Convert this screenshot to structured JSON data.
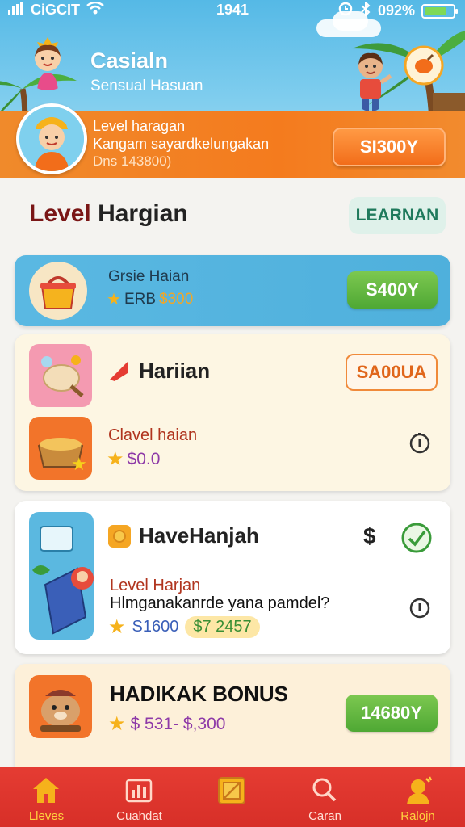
{
  "status_bar": {
    "carrier": "CiGCIT",
    "time": "1941",
    "battery": "092%",
    "battery_level": 0.8
  },
  "header": {
    "title": "Casialn",
    "subtitle": "Sensual Hasuan"
  },
  "banner": {
    "line1": "Level haragan",
    "line2": "Kangam sayardkelungakan",
    "line3": "Dns 143800)",
    "button_label": "SI300Y"
  },
  "section": {
    "title_part1": "Level",
    "title_part2": "Hargian",
    "learn_label": "LEARNAN"
  },
  "cards": [
    {
      "title": "Grsie Haian",
      "meta_a": "ERB",
      "meta_b": "$300",
      "button_label": "S400Y"
    },
    {
      "title": "Hariian",
      "button_label": "SA00UA",
      "sub_title": "Clavel haian",
      "sub_value": "$0.0"
    },
    {
      "title": "HaveHanjah",
      "dollar_symbol": "$",
      "sub_title": "Level Harjan",
      "sub_desc": "Hlmganakanrde yana pamdel?",
      "value_a": "S1600",
      "value_b": "$7 2457"
    },
    {
      "title": "HADIKAK BONUS",
      "value": "$ 531- $,300",
      "button_label": "14680Y"
    }
  ],
  "bottom_nav": [
    {
      "label": "Lleves",
      "icon": "home-icon"
    },
    {
      "label": "Cuahdat",
      "icon": "chart-icon"
    },
    {
      "label": "",
      "icon": "frame-icon"
    },
    {
      "label": "Caran",
      "icon": "search-icon"
    },
    {
      "label": "Ralojn",
      "icon": "profile-icon"
    }
  ],
  "colors": {
    "header_sky": "#55b9e6",
    "banner_orange": "#f47b1e",
    "green_button": "#4fa834",
    "nav_red": "#e53c33",
    "nav_active": "#ffd23f"
  }
}
